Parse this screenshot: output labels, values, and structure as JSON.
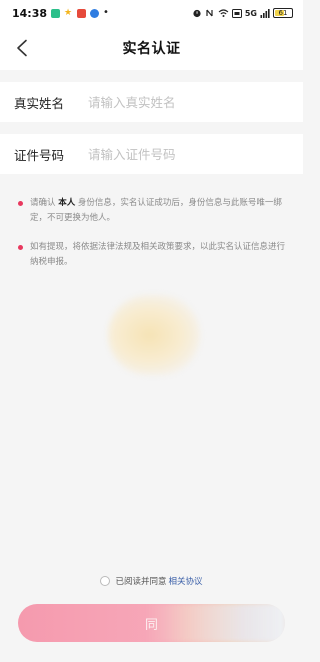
{
  "status_bar": {
    "time": "14:38",
    "dot": "•",
    "icons_left": [
      "app-green-icon",
      "star-icon",
      "app-red-icon",
      "app-blue-icon"
    ],
    "icons_right": [
      "alarm-icon",
      "nfc-icon",
      "wifi-icon",
      "hd-icon",
      "signal-icon"
    ],
    "signal_text": "5G",
    "battery_level_percent": 61,
    "battery_text": "61"
  },
  "nav": {
    "title": "实名认证",
    "back_icon": "chevron-left-icon"
  },
  "form": {
    "name_label": "真实姓名",
    "name_placeholder": "请输入真实姓名",
    "id_label": "证件号码",
    "id_placeholder": "请输入证件号码"
  },
  "notes": [
    {
      "prefix": "请确认 ",
      "strong": "本人",
      "suffix": " 身份信息，实名认证成功后，身份信息与此账号唯一绑定，不可更换为他人。"
    },
    {
      "text": "如有提现，将依据法律法规及相关政策要求，以此实名认证信息进行纳税申报。"
    }
  ],
  "agreement": {
    "text": "已阅读并同意",
    "link": "相关协议",
    "checked": false
  },
  "submit": {
    "label": "同"
  },
  "colors": {
    "accent_red": "#e8385e",
    "link_blue": "#3a5fa8",
    "button_pink": "#f59aae"
  }
}
